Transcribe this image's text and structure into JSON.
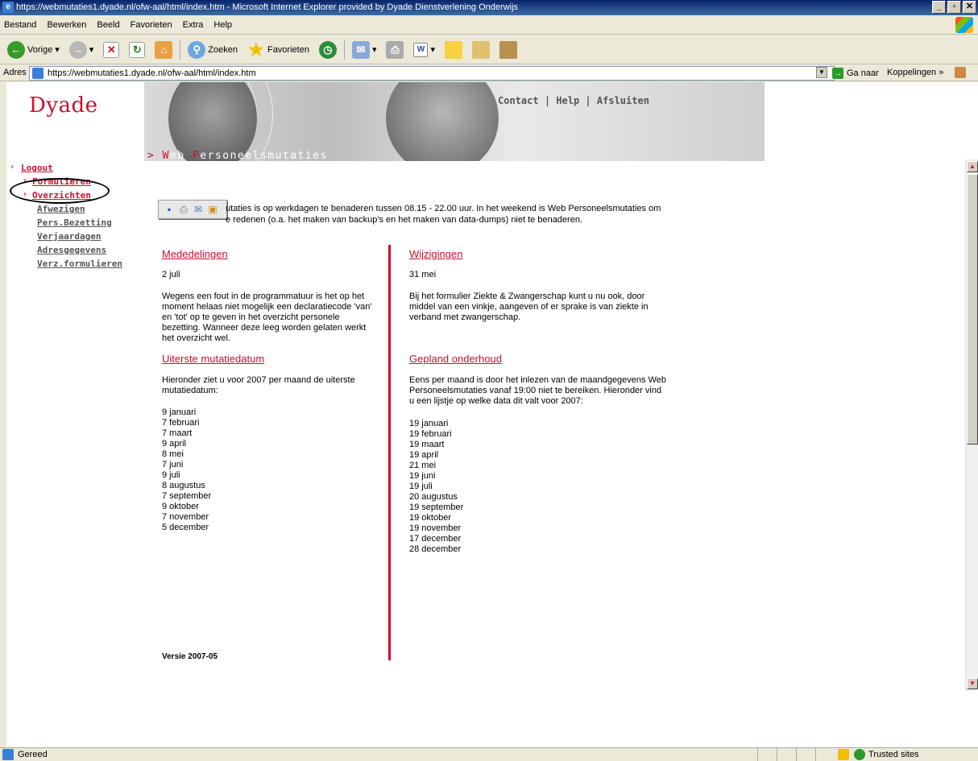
{
  "window": {
    "title": "https://webmutaties1.dyade.nl/ofw-aal/html/index.htm - Microsoft Internet Explorer provided by Dyade Dienstverlening Onderwijs"
  },
  "menu": [
    "Bestand",
    "Bewerken",
    "Beeld",
    "Favorieten",
    "Extra",
    "Help"
  ],
  "toolbar": {
    "back": "Vorige",
    "search": "Zoeken",
    "favorites": "Favorieten"
  },
  "addressbar": {
    "label": "Adres",
    "url": "https://webmutaties1.dyade.nl/ofw-aal/html/index.htm",
    "go": "Ga naar",
    "links": "Koppelingen"
  },
  "page": {
    "logo": "Dyade",
    "banner_title_prefix": ">",
    "banner_title_w": "W",
    "banner_title_rest1": "eb ",
    "banner_title_p": "P",
    "banner_title_rest2": "ersoneelsmutaties",
    "toplinks": {
      "contact": "Contact",
      "help": "Help",
      "afsluiten": "Afsluiten",
      "separator": "|"
    },
    "nav": {
      "logout": "Logout",
      "formulieren": "Formulieren",
      "overzichten": "Overzichten",
      "afwezigen": "Afwezigen",
      "persbezetting": "Pers.Bezetting",
      "verjaardagen": "Verjaardagen",
      "adresgegevens": "Adresgegevens",
      "verzformulieren": "Verz.formulieren"
    },
    "intro_line1": "utaties is op werkdagen te benaderen tussen 08.15 - 22.00 uur. In het weekend is Web Personeelsmutaties om",
    "intro_line2": "e redenen (o.a. het maken van backup's en het maken van data-dumps) niet te benaderen.",
    "mededelingen": {
      "heading": "Mededelingen",
      "date": "2 juli",
      "text": "Wegens een fout in de programmatuur is het op het moment helaas niet mogelijk een declaratiecode 'van' en 'tot' op te geven in het overzicht personele bezetting. Wanneer deze leeg worden gelaten werkt het overzicht wel."
    },
    "wijzigingen": {
      "heading": "Wijzigingen",
      "date": "31 mei",
      "text": "Bij het formulier Ziekte & Zwangerschap kunt u nu ook, door middel van een vinkje, aangeven of er sprake is van ziekte in verband met zwangerschap."
    },
    "uiterste": {
      "heading": "Uiterste mutatiedatum",
      "text": "Hieronder ziet u voor 2007 per maand de uiterste mutatiedatum:",
      "dates": [
        "9 januari",
        "7 februari",
        "7 maart",
        "9 april",
        "8 mei",
        "7 juni",
        "9 juli",
        "8 augustus",
        "7 september",
        "9 oktober",
        "7 november",
        "5 december"
      ]
    },
    "onderhoud": {
      "heading": "Gepland onderhoud",
      "text": "Eens per maand is door het inlezen van de maandgegevens Web Personeelsmutaties vanaf 19:00 niet te bereiken. Hieronder vind u een lijstje op welke data dit valt voor 2007:",
      "dates": [
        "19 januari",
        "19 februari",
        "19 maart",
        "19 april",
        "21 mei",
        "19 juni",
        "19 juli",
        "20 augustus",
        "19 september",
        "19 oktober",
        "19 november",
        "17 december",
        "28 december"
      ]
    },
    "versie": "Versie 2007-05"
  },
  "status": {
    "message": "Gereed",
    "zone": "Trusted sites"
  },
  "colors": {
    "brand_red": "#c8102e"
  }
}
